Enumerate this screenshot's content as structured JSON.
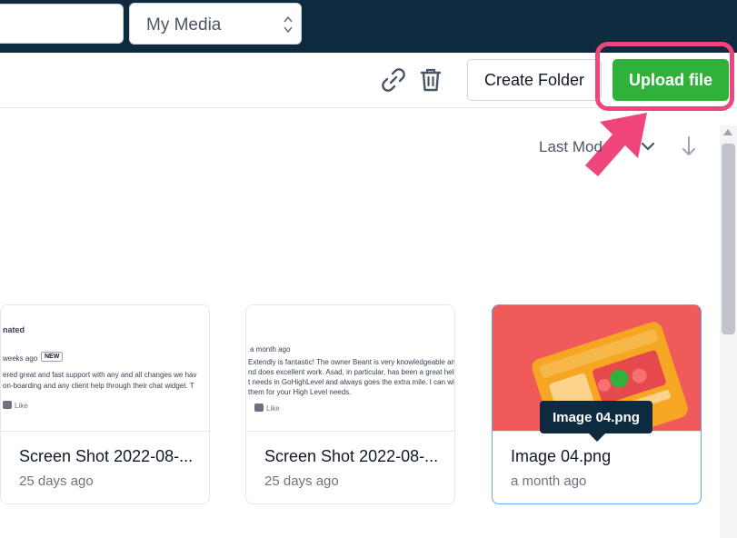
{
  "header": {
    "media_select": {
      "selected": "My Media"
    }
  },
  "toolbar": {
    "create_folder_label": "Create Folder",
    "upload_label": "Upload file"
  },
  "sort": {
    "label": "Last Mod"
  },
  "files": [
    {
      "title": "Screen Shot 2022-08-...",
      "time": "25 days ago",
      "preview": {
        "heading": "nated",
        "meta": "weeks ago",
        "badge": "NEW",
        "line1": "ered great and fast support with any and all changes we hav",
        "line2": "on-boarding and any client help through their chat widget. T",
        "like": "Like"
      }
    },
    {
      "title": "Screen Shot 2022-08-...",
      "time": "25 days ago",
      "preview": {
        "meta": "a month ago",
        "line1": "Extendly is fantastic! The owner Beant is very knowledgeable and he",
        "line2": "nd does excellent work. Asad, in particular, has been a great help to c",
        "line3": "t needs in GoHighLevel and always goes the extra mile. I can with gr",
        "line4": "them for your High Level needs.",
        "like": "Like"
      }
    },
    {
      "title": "Image 04.png",
      "time": "a month ago",
      "tooltip": "Image 04.png"
    }
  ],
  "colors": {
    "topbar": "#0e2a3e",
    "upload_button": "#2fb13a",
    "highlight": "#f0457b",
    "selected_border": "#60a5fa"
  }
}
